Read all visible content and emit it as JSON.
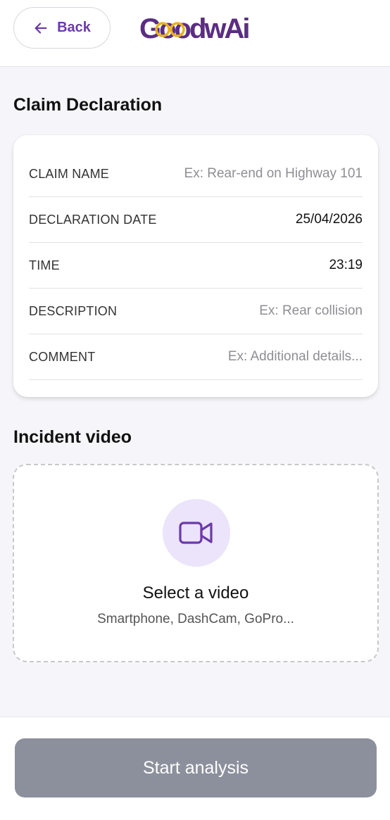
{
  "header": {
    "back_label": "Back",
    "logo_text": "GoodwAi"
  },
  "claim_section": {
    "title": "Claim Declaration",
    "fields": [
      {
        "label": "CLAIM NAME",
        "value": "",
        "placeholder": "Ex: Rear-end on Highway 101"
      },
      {
        "label": "DECLARATION DATE",
        "value": "25/04/2026",
        "placeholder": ""
      },
      {
        "label": "TIME",
        "value": "23:19",
        "placeholder": ""
      },
      {
        "label": "DESCRIPTION",
        "value": "",
        "placeholder": "Ex: Rear collision"
      },
      {
        "label": "COMMENT",
        "value": "",
        "placeholder": "Ex: Additional details..."
      }
    ]
  },
  "video_section": {
    "title": "Incident video",
    "icon": "video-camera-icon",
    "select_label": "Select a video",
    "sources": "Smartphone, DashCam, GoPro..."
  },
  "footer": {
    "start_label": "Start analysis"
  },
  "colors": {
    "accent": "#6b3aa8",
    "logo_gold": "#e9b21f",
    "icon_bg": "#ece4fb",
    "button_disabled": "#8c909c"
  }
}
